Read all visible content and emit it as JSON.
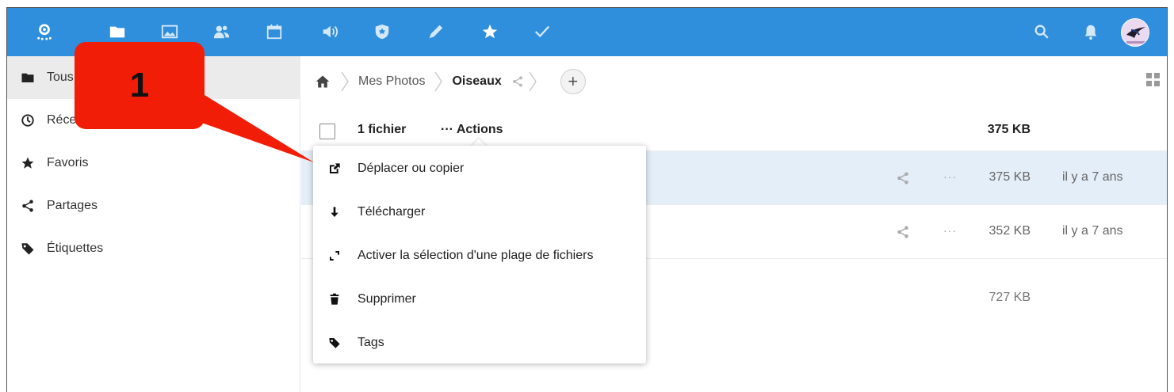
{
  "header": {
    "icons": [
      "logo-icon",
      "files-icon",
      "photos-icon",
      "contacts-icon",
      "calendar-icon",
      "announcements-icon",
      "passwords-icon",
      "notes-icon",
      "bookmarks-icon",
      "tasks-icon",
      "search-icon",
      "bell-icon"
    ],
    "brand_color": "#2f8fdd"
  },
  "sidebar": {
    "items": [
      {
        "label": "Tous",
        "icon": "folder-icon"
      },
      {
        "label": "Récents",
        "icon": "clock-icon"
      },
      {
        "label": "Favoris",
        "icon": "star-icon"
      },
      {
        "label": "Partages",
        "icon": "share-icon"
      },
      {
        "label": "Étiquettes",
        "icon": "tag-icon"
      }
    ]
  },
  "breadcrumb": {
    "items": [
      "Mes Photos",
      "Oiseaux"
    ],
    "add_label": "+"
  },
  "list": {
    "header": {
      "count": "1 fichier",
      "actions": "··· Actions",
      "size": "375 KB"
    },
    "rows": [
      {
        "size": "375 KB",
        "date": "il y a 7 ans",
        "more": "···",
        "selected": true
      },
      {
        "size": "352 KB",
        "date": "il y a 7 ans",
        "more": "···",
        "selected": false
      }
    ],
    "total_size": "727 KB"
  },
  "actions_menu": {
    "items": [
      {
        "label": "Déplacer ou copier",
        "icon": "external-link-icon"
      },
      {
        "label": "Télécharger",
        "icon": "download-icon"
      },
      {
        "label": "Activer la sélection d'une plage de fichiers",
        "icon": "range-select-icon"
      },
      {
        "label": "Supprimer",
        "icon": "trash-icon"
      },
      {
        "label": "Tags",
        "icon": "tag-icon"
      }
    ]
  },
  "annotation": {
    "number": "1",
    "color": "#f21d06"
  }
}
